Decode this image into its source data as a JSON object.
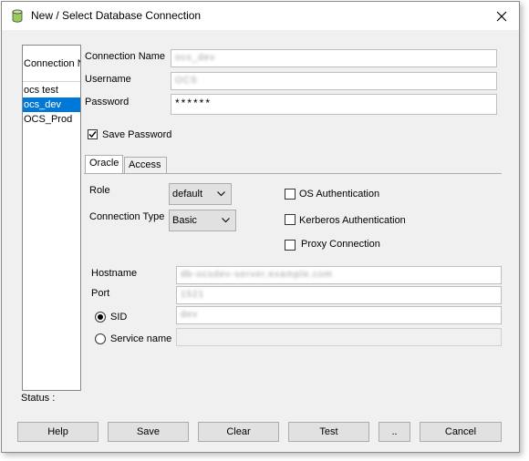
{
  "window": {
    "title": "New / Select Database Connection"
  },
  "connection_list": {
    "header": "Connection Name",
    "items": [
      {
        "label": "ocs test",
        "selected": false
      },
      {
        "label": "ocs_dev",
        "selected": true
      },
      {
        "label": "OCS_Prod",
        "selected": false
      }
    ]
  },
  "form": {
    "connection_name_label": "Connection Name",
    "connection_name_value": "ocs_dev",
    "username_label": "Username",
    "username_value": "OCS",
    "password_label": "Password",
    "password_value": "******",
    "save_password_label": "Save Password",
    "save_password_checked": true
  },
  "tabs": [
    {
      "label": "Oracle",
      "active": true
    },
    {
      "label": "Access",
      "active": false
    }
  ],
  "oracle": {
    "role_label": "Role",
    "role_value": "default",
    "connection_type_label": "Connection Type",
    "connection_type_value": "Basic",
    "os_auth_label": "OS Authentication",
    "kerberos_auth_label": "Kerberos Authentication",
    "proxy_label": "Proxy Connection",
    "hostname_label": "Hostname",
    "hostname_value": "db-ocsdev-server.example.com",
    "port_label": "Port",
    "port_value": "1521",
    "sid_label": "SID",
    "sid_value": "dev",
    "sid_selected": true,
    "service_name_label": "Service name",
    "service_name_value": ""
  },
  "status_label": "Status :",
  "buttons": {
    "help": "Help",
    "save": "Save",
    "clear": "Clear",
    "test": "Test",
    "more": "..",
    "cancel": "Cancel"
  },
  "colors": {
    "selection": "#0078d7",
    "window_bg": "#f0f0f0"
  }
}
